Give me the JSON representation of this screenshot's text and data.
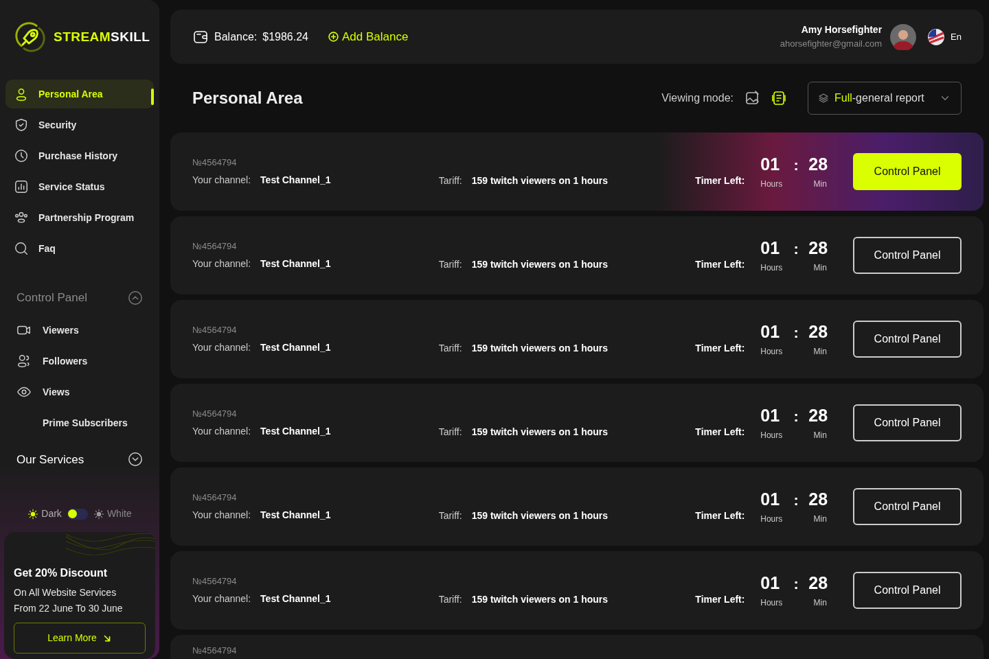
{
  "logo": {
    "part1": "STREAM",
    "part2": "SKILL"
  },
  "nav": [
    {
      "label": "Personal Area",
      "selected": true
    },
    {
      "label": "Security",
      "selected": false
    },
    {
      "label": "Purchase History",
      "selected": false
    },
    {
      "label": "Service Status",
      "selected": false
    },
    {
      "label": "Partnership Program",
      "selected": false
    },
    {
      "label": "Faq",
      "selected": false
    }
  ],
  "sections": [
    {
      "title": "Control Panel",
      "expanded": true,
      "items": [
        {
          "label": "Viewers"
        },
        {
          "label": "Followers"
        },
        {
          "label": "Views"
        },
        {
          "label": "Prime Subscribers"
        }
      ]
    },
    {
      "title": "Our Services",
      "expanded": false
    }
  ],
  "theme": [
    {
      "label": "Dark",
      "selected": true
    },
    {
      "label": "White",
      "selected": false
    }
  ],
  "promo": {
    "title": "Get 20% Discount",
    "line1": "On All Website Services",
    "line2": "From 22 June To 30 June",
    "button": "Learn More"
  },
  "header": {
    "balance_label": "Balance:",
    "balance": "$1986.24",
    "add": "Add Balance",
    "user_name": "Amy Horsefighter",
    "email": "ahorsefighter@gmail.com",
    "language": "En"
  },
  "page_title": "Personal Area",
  "viewing_mode": {
    "label": "Viewing mode:",
    "options": [
      {
        "kind": "gallery",
        "selected": false
      },
      {
        "kind": "list",
        "selected": true
      }
    ]
  },
  "report": {
    "prefix": "Full",
    "rest": "-general report"
  },
  "orders": [
    {
      "number": "№4564794",
      "channel_label": "Your channel:",
      "channel": "Test Channel_1",
      "tariff_label": "Tariff:",
      "tariff": "159 twitch viewers on 1 hours",
      "timer_label": "Timer Left:",
      "hours": "01",
      "separator": ":",
      "minutes": "28",
      "hours_label": "Hours",
      "minutes_label": "Min",
      "button": "Control Panel",
      "highlighted": true
    },
    {
      "number": "№4564794",
      "channel_label": "Your channel:",
      "channel": "Test Channel_1",
      "tariff_label": "Tariff:",
      "tariff": "159 twitch viewers on 1 hours",
      "timer_label": "Timer Left:",
      "hours": "01",
      "separator": ":",
      "minutes": "28",
      "hours_label": "Hours",
      "minutes_label": "Min",
      "button": "Control Panel",
      "highlighted": false
    },
    {
      "number": "№4564794",
      "channel_label": "Your channel:",
      "channel": "Test Channel_1",
      "tariff_label": "Tariff:",
      "tariff": "159 twitch viewers on 1 hours",
      "timer_label": "Timer Left:",
      "hours": "01",
      "separator": ":",
      "minutes": "28",
      "hours_label": "Hours",
      "minutes_label": "Min",
      "button": "Control Panel",
      "highlighted": false
    },
    {
      "number": "№4564794",
      "channel_label": "Your channel:",
      "channel": "Test Channel_1",
      "tariff_label": "Tariff:",
      "tariff": "159 twitch viewers on 1 hours",
      "timer_label": "Timer Left:",
      "hours": "01",
      "separator": ":",
      "minutes": "28",
      "hours_label": "Hours",
      "minutes_label": "Min",
      "button": "Control Panel",
      "highlighted": false
    },
    {
      "number": "№4564794",
      "channel_label": "Your channel:",
      "channel": "Test Channel_1",
      "tariff_label": "Tariff:",
      "tariff": "159 twitch viewers on 1 hours",
      "timer_label": "Timer Left:",
      "hours": "01",
      "separator": ":",
      "minutes": "28",
      "hours_label": "Hours",
      "minutes_label": "Min",
      "button": "Control Panel",
      "highlighted": false
    },
    {
      "number": "№4564794",
      "channel_label": "Your channel:",
      "channel": "Test Channel_1",
      "tariff_label": "Tariff:",
      "tariff": "159 twitch viewers on 1 hours",
      "timer_label": "Timer Left:",
      "hours": "01",
      "separator": ":",
      "minutes": "28",
      "hours_label": "Hours",
      "minutes_label": "Min",
      "button": "Control Panel",
      "highlighted": false
    },
    {
      "kind": "cut",
      "number": "№4564794"
    }
  ]
}
